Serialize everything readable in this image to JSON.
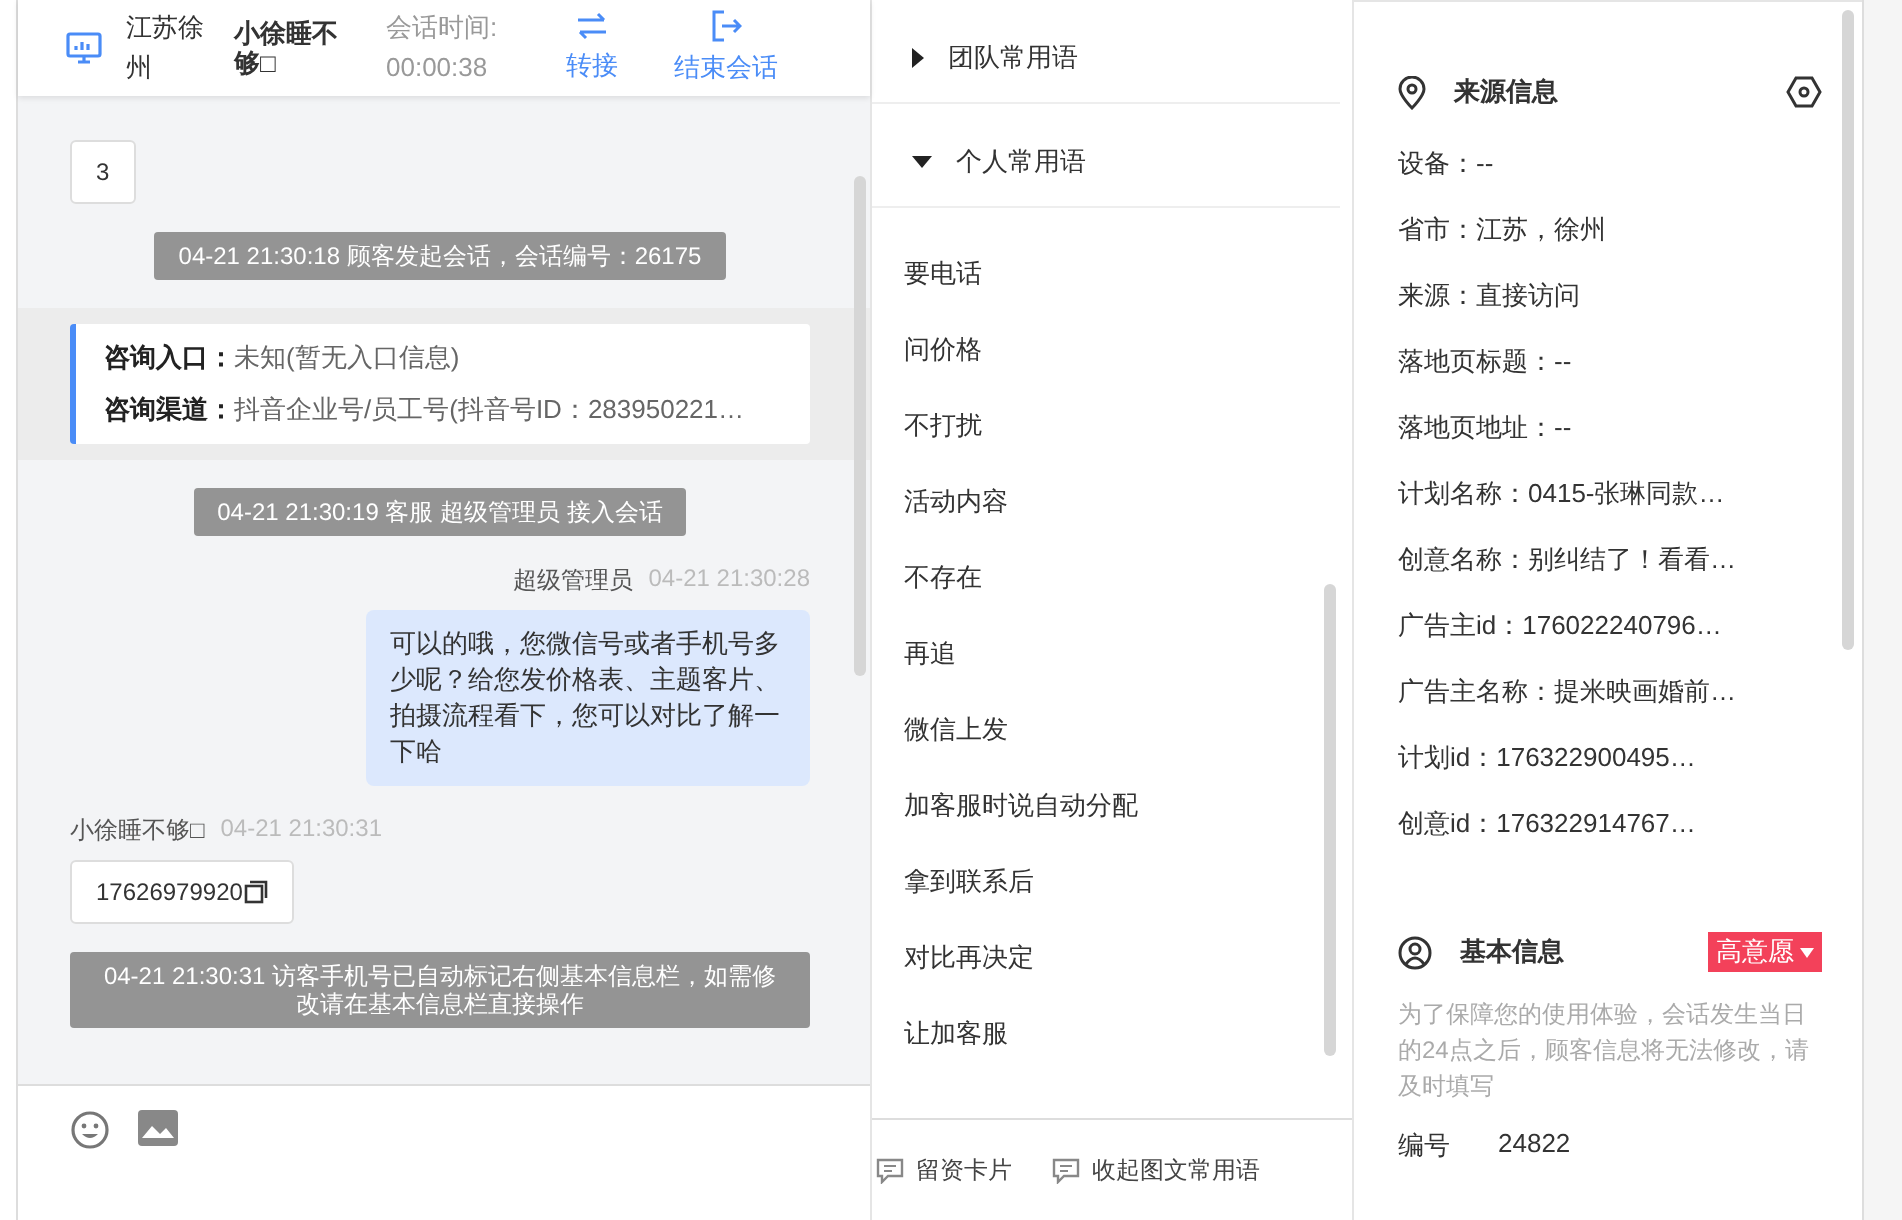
{
  "header": {
    "location": "江苏徐州",
    "visitor": "小徐睡不够□",
    "timer_label": "会话时间:",
    "timer_value": "00:00:38",
    "actions": [
      {
        "kind": "transfer",
        "label": "转接"
      },
      {
        "kind": "end",
        "label": "结束会话"
      }
    ]
  },
  "chat": {
    "messages": [
      {
        "kind": "visitor",
        "text": "3",
        "copyable": false
      },
      {
        "kind": "system",
        "text": "04-21 21:30:18 顾客发起会话，会话编号：26175"
      },
      {
        "kind": "entry_info",
        "rows": [
          {
            "label": "咨询入口：",
            "value": "未知(暂无入口信息)"
          },
          {
            "label": "咨询渠道：",
            "value": "抖音企业号/员工号(抖音号ID：283950221…"
          }
        ]
      },
      {
        "kind": "system",
        "text": "04-21 21:30:19 客服 超级管理员 接入会话"
      },
      {
        "kind": "agent",
        "name": "超级管理员",
        "time": "04-21 21:30:28",
        "text": "可以的哦，您微信号或者手机号多少呢？给您发价格表、主题客片、拍摄流程看下，您可以对比了解一下哈"
      },
      {
        "kind": "visitor",
        "name": "小徐睡不够□",
        "time": "04-21 21:30:31",
        "text": "17626979920",
        "copyable": true
      },
      {
        "kind": "system",
        "text": "04-21 21:30:31 访客手机号已自动标记右侧基本信息栏，如需修改请在基本信息栏直接操作"
      }
    ]
  },
  "chat_tools": [
    {
      "kind": "emoji"
    },
    {
      "kind": "image"
    }
  ],
  "phrase_groups": [
    {
      "title": "团队常用语",
      "expanded": false
    },
    {
      "title": "个人常用语",
      "expanded": true,
      "items": [
        "要电话",
        "问价格",
        "不打扰",
        "活动内容",
        "不存在",
        "再追",
        "微信上发",
        "加客服时说自动分配",
        "拿到联系后",
        "对比再决定",
        "让加客服"
      ]
    }
  ],
  "phrase_footer": [
    "留资卡片",
    "收起图文常用语"
  ],
  "source_info": {
    "title": "来源信息",
    "fields": [
      "设备：--",
      "省市：江苏，徐州",
      "来源：直接访问",
      "落地页标题：--",
      "落地页地址：--",
      "计划名称：0415-张琳同款…",
      "创意名称：别纠结了！看看…",
      "广告主id：176022240796…",
      "广告主名称：提米映画婚前…",
      "计划id：176322900495…",
      "创意id：176322914767…"
    ]
  },
  "basic_info": {
    "title": "基本信息",
    "intent": "高意愿",
    "notice": "为了保障您的使用体验，会话发生当日的24点之后，顾客信息将无法修改，请及时填写",
    "fields": [
      {
        "label": "编号",
        "value": "24822"
      }
    ]
  }
}
